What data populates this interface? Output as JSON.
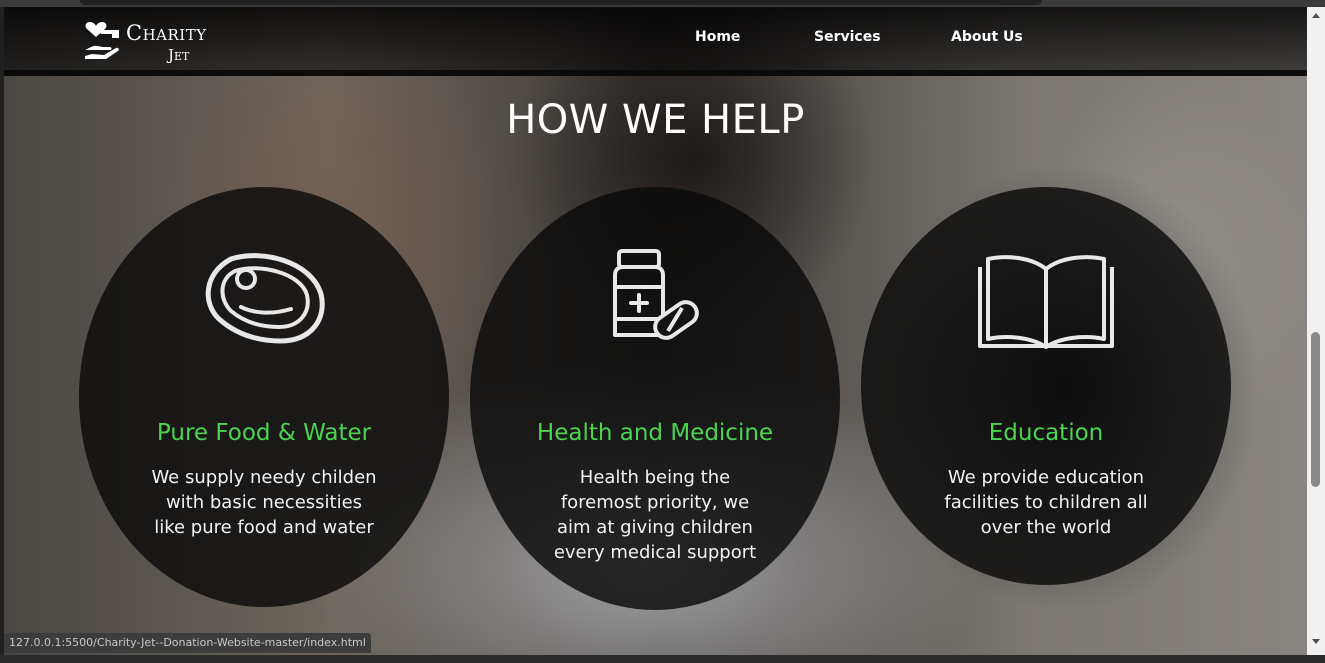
{
  "site": {
    "logo_line1": "Charity",
    "logo_line2": "Jet"
  },
  "nav": {
    "items": [
      {
        "label": "Home"
      },
      {
        "label": "Services"
      },
      {
        "label": "About Us"
      }
    ]
  },
  "section": {
    "heading": "HOW WE HELP",
    "cards": [
      {
        "icon": "steak-icon",
        "title": "Pure Food & Water",
        "lines": [
          "We supply needy childen",
          "with basic necessities",
          "like pure food and water"
        ]
      },
      {
        "icon": "medicine-bottle-icon",
        "title": "Health and Medicine",
        "lines": [
          "Health being the",
          "foremost priority, we",
          "aim at giving children",
          "every medical support"
        ]
      },
      {
        "icon": "open-book-icon",
        "title": "Education",
        "lines": [
          "We provide education",
          "facilities to children all",
          "over the world"
        ]
      }
    ]
  },
  "browser": {
    "status_url": "127.0.0.1:5500/Charity-Jet--Donation-Website-master/index.html"
  },
  "colors": {
    "accent_green": "#4bd44e",
    "card_background": "rgba(10,10,10,0.82)",
    "navbar": "#000000"
  }
}
